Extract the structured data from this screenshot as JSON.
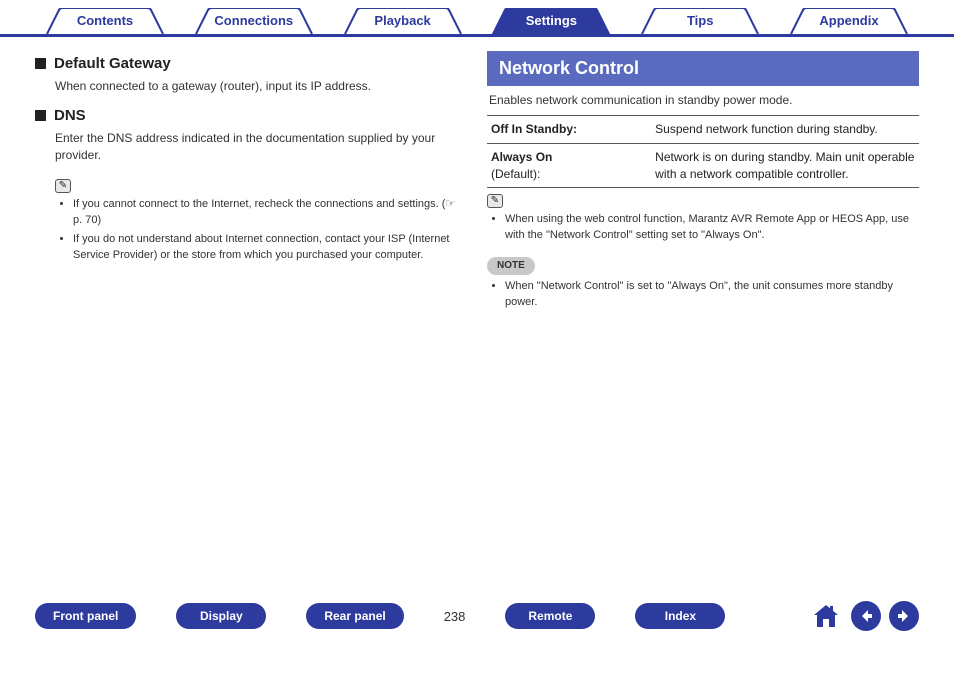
{
  "tabs": {
    "contents": "Contents",
    "connections": "Connections",
    "playback": "Playback",
    "settings": "Settings",
    "tips": "Tips",
    "appendix": "Appendix",
    "active": "settings"
  },
  "left": {
    "gateway": {
      "title": "Default Gateway",
      "body": "When connected to a gateway (router), input its IP address."
    },
    "dns": {
      "title": "DNS",
      "body": "Enter the DNS address indicated in the documentation supplied by your provider."
    },
    "notes": {
      "n1": "If you cannot connect to the Internet, recheck the connections and settings. (☞ p. 70)",
      "n2": "If you do not understand about Internet connection, contact your ISP (Internet Service Provider) or the store from which you purchased your computer."
    }
  },
  "right": {
    "title": "Network Control",
    "desc": "Enables network communication in standby power mode.",
    "opt1": {
      "label": "Off In Standby:",
      "value": "Suspend network function during standby."
    },
    "opt2": {
      "label_a": "Always On",
      "label_b": "(Default):",
      "value": "Network is on during standby. Main unit operable with a network compatible controller."
    },
    "tip": "When using the web control function, Marantz AVR Remote App or HEOS App, use with the \"Network Control\" setting set to \"Always On\".",
    "note_label": "NOTE",
    "note_body": "When \"Network Control\" is set to \"Always On\", the unit consumes more standby power."
  },
  "footer": {
    "front": "Front panel",
    "display": "Display",
    "rear": "Rear panel",
    "page": "238",
    "remote": "Remote",
    "index": "Index"
  }
}
